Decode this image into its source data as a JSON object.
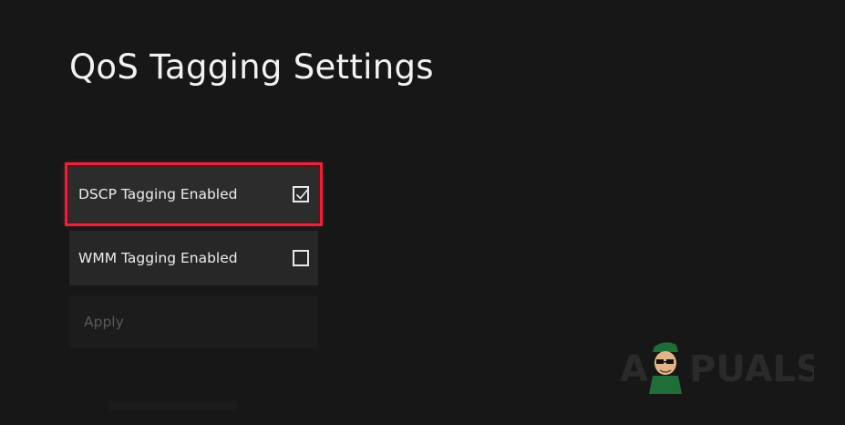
{
  "page": {
    "title": "QoS Tagging Settings"
  },
  "options": [
    {
      "label": "DSCP Tagging Enabled",
      "checked": true,
      "focused": true
    },
    {
      "label": "WMM Tagging Enabled",
      "checked": false,
      "focused": false
    }
  ],
  "apply": {
    "label": "Apply",
    "enabled": false
  },
  "watermark": {
    "text": "APPUALS"
  },
  "colors": {
    "background": "#171717",
    "focus_ring": "#e3253e",
    "option_bg": "#272727",
    "text": "#ececec",
    "disabled_text": "#5a5a5a"
  }
}
